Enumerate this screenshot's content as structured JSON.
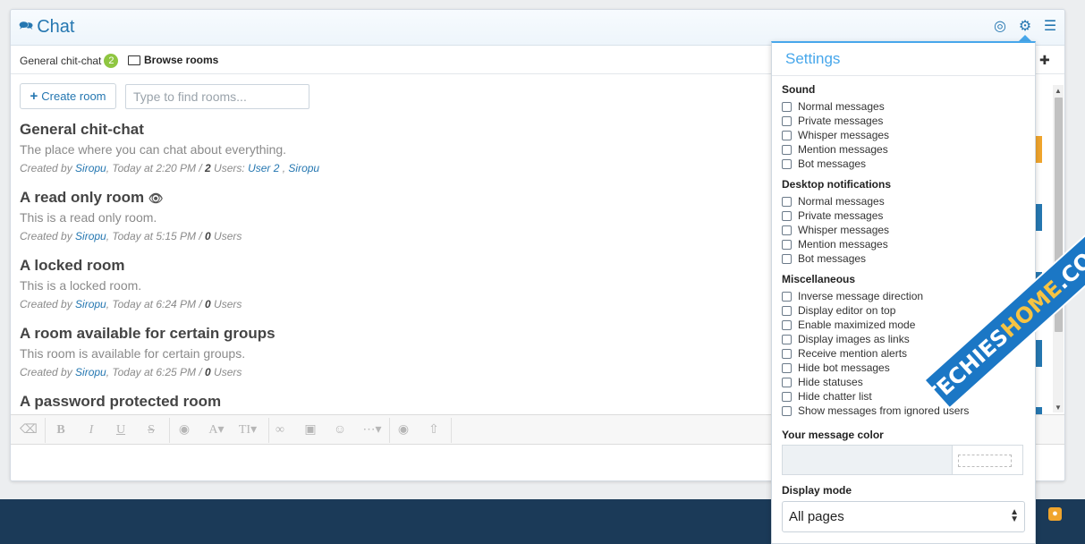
{
  "header": {
    "title": "Chat"
  },
  "tabs": {
    "general_label": "General chit-chat",
    "general_count": "2",
    "browse_label": "Browse rooms"
  },
  "toolbar": {
    "create_label": "Create room",
    "find_placeholder": "Type to find rooms..."
  },
  "rooms": [
    {
      "name": "General chit-chat",
      "desc": "The place where you can chat about everything.",
      "created_prefix": "Created by ",
      "creator": "Siropu",
      "time": ", Today at 2:20 PM / ",
      "users": "2",
      "users_label": " Users: ",
      "user1": "User 2",
      "sep": " , ",
      "user2": "Siropu"
    },
    {
      "name": "A read only room",
      "desc": "This is a read only room.",
      "created_prefix": "Created by ",
      "creator": "Siropu",
      "time": ", Today at 5:15 PM / ",
      "users": "0",
      "users_label": " Users"
    },
    {
      "name": "A locked room",
      "desc": "This is a locked room.",
      "created_prefix": "Created by ",
      "creator": "Siropu",
      "time": ", Today at 6:24 PM / ",
      "users": "0",
      "users_label": " Users"
    },
    {
      "name": "A room available for certain groups",
      "desc": "This room is available for certain groups.",
      "created_prefix": "Created by ",
      "creator": "Siropu",
      "time": ", Today at 6:25 PM / ",
      "users": "0",
      "users_label": " Users"
    },
    {
      "name": "A password protected room"
    }
  ],
  "settings": {
    "title": "Settings",
    "sound": {
      "title": "Sound",
      "items": [
        "Normal messages",
        "Private messages",
        "Whisper messages",
        "Mention messages",
        "Bot messages"
      ]
    },
    "desktop": {
      "title": "Desktop notifications",
      "items": [
        "Normal messages",
        "Private messages",
        "Whisper messages",
        "Mention messages",
        "Bot messages"
      ]
    },
    "misc": {
      "title": "Miscellaneous",
      "items": [
        "Inverse message direction",
        "Display editor on top",
        "Enable maximized mode",
        "Display images as links",
        "Receive mention alerts",
        "Hide bot messages",
        "Hide statuses",
        "Hide chatter list",
        "Show messages from ignored users"
      ]
    },
    "color_title": "Your message color",
    "display_mode_title": "Display mode",
    "display_mode_value": "All pages"
  },
  "watermark": {
    "part1": "TECHIES",
    "part2": "HOME",
    "part3": ".COM"
  },
  "colors": {
    "accent": "#2577b1",
    "settings_accent": "#47a7eb",
    "footer": "#1b3a58",
    "badge": "#8fc641"
  }
}
